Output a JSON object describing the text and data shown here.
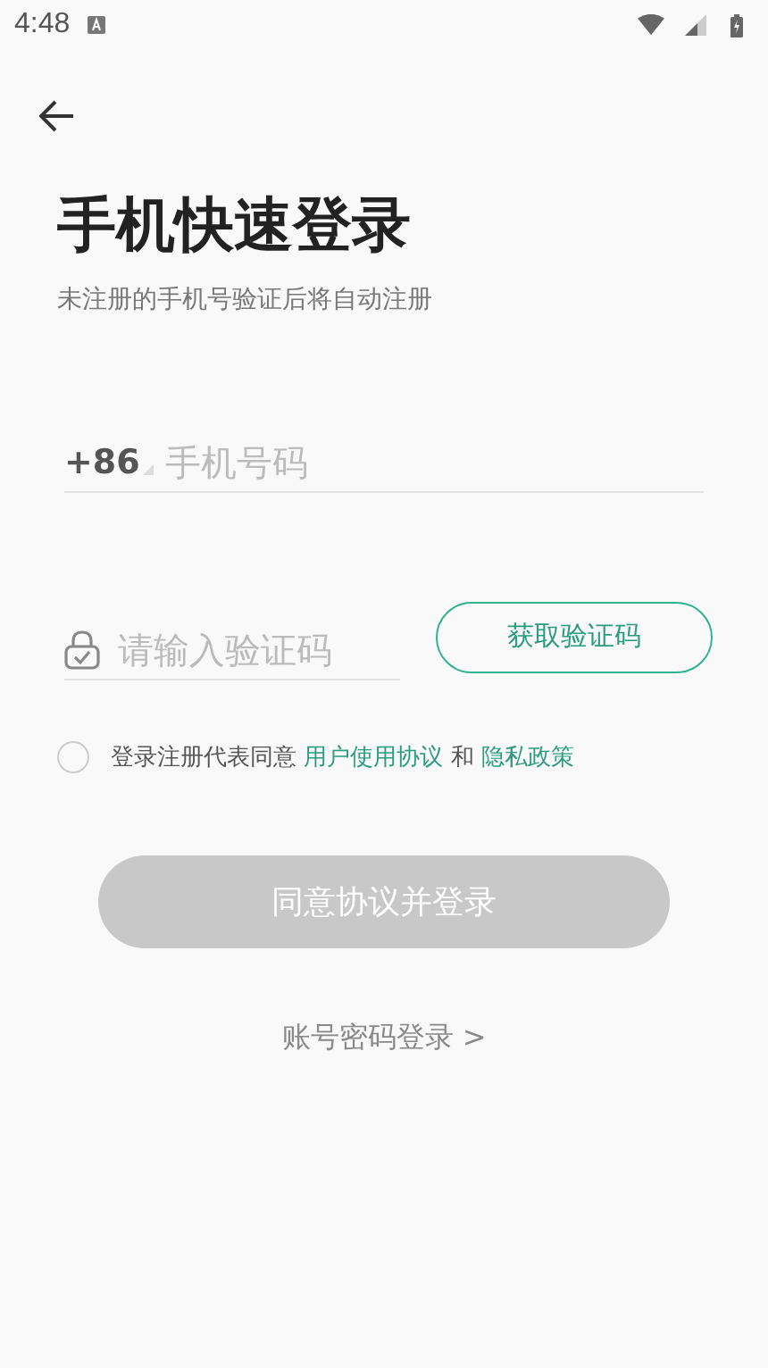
{
  "status_bar": {
    "time": "4:48"
  },
  "title": "手机快速登录",
  "subtitle": "未注册的手机号验证后将自动注册",
  "phone": {
    "prefix": "+86",
    "placeholder": "手机号码"
  },
  "code": {
    "placeholder": "请输入验证码",
    "button": "获取验证码"
  },
  "agreement": {
    "checked": false,
    "text": "登录注册代表同意",
    "links": [
      "用户使用协议",
      "隐私政策"
    ],
    "joiner": "和"
  },
  "login_button": {
    "label": "同意协议并登录",
    "disabled": true
  },
  "alt_login": "账号密码登录 >"
}
